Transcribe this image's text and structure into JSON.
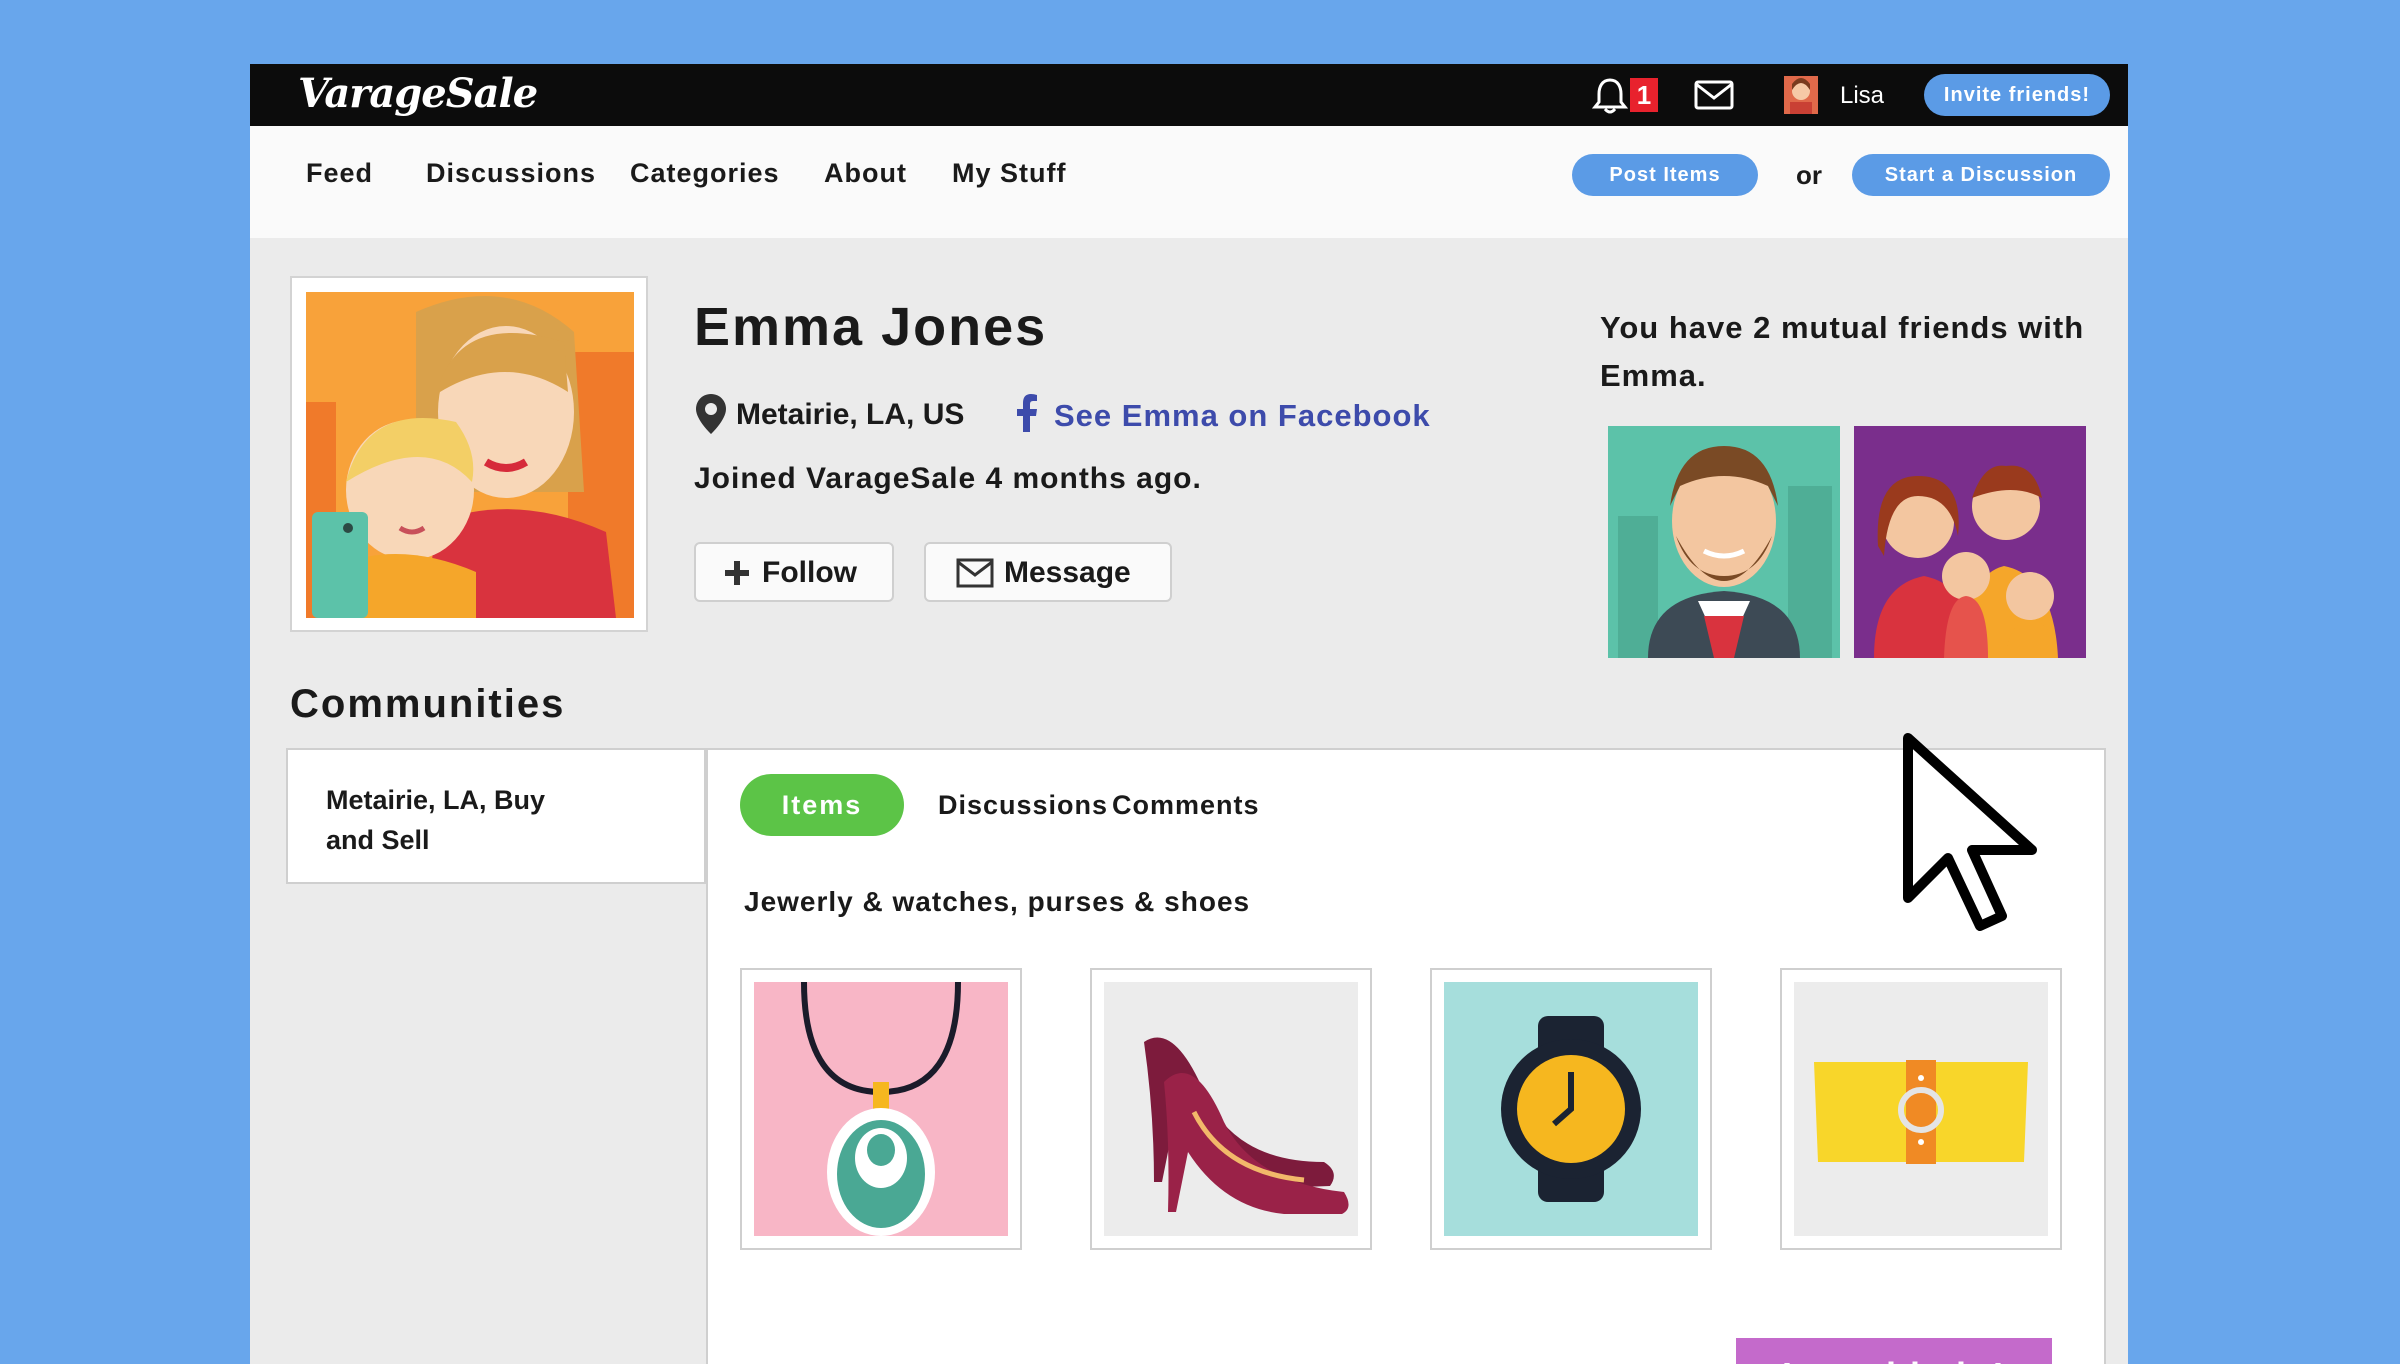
{
  "app": {
    "logo": "VarageSale"
  },
  "topbar": {
    "notification_count": "1",
    "user_name": "Lisa",
    "invite_label": "Invite friends!"
  },
  "nav": {
    "items": [
      "Feed",
      "Discussions",
      "Categories",
      "About",
      "My Stuff"
    ],
    "post_items_label": "Post Items",
    "or_label": "or",
    "start_discussion_label": "Start a Discussion"
  },
  "profile": {
    "name": "Emma Jones",
    "location": "Metairie, LA, US",
    "facebook_link": "See Emma on Facebook",
    "joined": "Joined VarageSale 4 months ago.",
    "follow_label": "Follow",
    "message_label": "Message"
  },
  "mutual": {
    "text": "You have 2 mutual friends with Emma."
  },
  "communities": {
    "title": "Communities",
    "selected": "Metairie, LA, Buy and Sell",
    "tabs": [
      "Items",
      "Discussions",
      "Comments"
    ],
    "category": "Jewerly & watches, purses & shoes",
    "help_label": "I need help!"
  },
  "colors": {
    "background": "#68a6ec",
    "accent_blue": "#5b9be6",
    "green_tab": "#5cc447",
    "help_purple": "#c46acb",
    "facebook_blue": "#3d4bab",
    "badge_red": "#e8222d"
  },
  "items": [
    {
      "icon": "necklace-icon"
    },
    {
      "icon": "high-heels-icon"
    },
    {
      "icon": "watch-icon"
    },
    {
      "icon": "purse-icon"
    }
  ]
}
